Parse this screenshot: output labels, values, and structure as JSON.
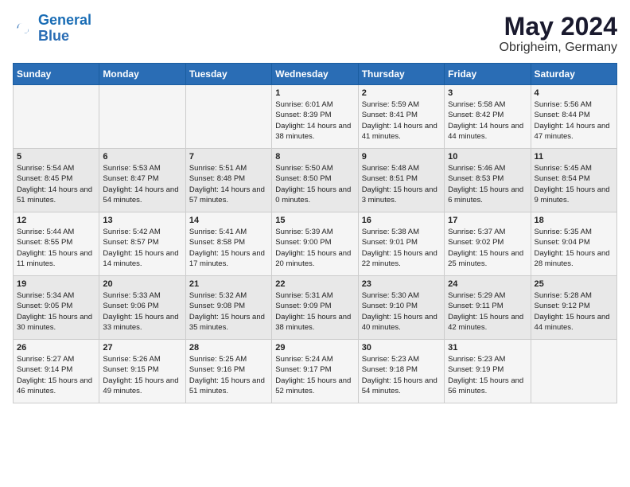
{
  "logo": {
    "line1": "General",
    "line2": "Blue"
  },
  "title": {
    "month_year": "May 2024",
    "location": "Obrigheim, Germany"
  },
  "days_of_week": [
    "Sunday",
    "Monday",
    "Tuesday",
    "Wednesday",
    "Thursday",
    "Friday",
    "Saturday"
  ],
  "weeks": [
    [
      {
        "day": "",
        "sunrise": "",
        "sunset": "",
        "daylight": ""
      },
      {
        "day": "",
        "sunrise": "",
        "sunset": "",
        "daylight": ""
      },
      {
        "day": "",
        "sunrise": "",
        "sunset": "",
        "daylight": ""
      },
      {
        "day": "1",
        "sunrise": "Sunrise: 6:01 AM",
        "sunset": "Sunset: 8:39 PM",
        "daylight": "Daylight: 14 hours and 38 minutes."
      },
      {
        "day": "2",
        "sunrise": "Sunrise: 5:59 AM",
        "sunset": "Sunset: 8:41 PM",
        "daylight": "Daylight: 14 hours and 41 minutes."
      },
      {
        "day": "3",
        "sunrise": "Sunrise: 5:58 AM",
        "sunset": "Sunset: 8:42 PM",
        "daylight": "Daylight: 14 hours and 44 minutes."
      },
      {
        "day": "4",
        "sunrise": "Sunrise: 5:56 AM",
        "sunset": "Sunset: 8:44 PM",
        "daylight": "Daylight: 14 hours and 47 minutes."
      }
    ],
    [
      {
        "day": "5",
        "sunrise": "Sunrise: 5:54 AM",
        "sunset": "Sunset: 8:45 PM",
        "daylight": "Daylight: 14 hours and 51 minutes."
      },
      {
        "day": "6",
        "sunrise": "Sunrise: 5:53 AM",
        "sunset": "Sunset: 8:47 PM",
        "daylight": "Daylight: 14 hours and 54 minutes."
      },
      {
        "day": "7",
        "sunrise": "Sunrise: 5:51 AM",
        "sunset": "Sunset: 8:48 PM",
        "daylight": "Daylight: 14 hours and 57 minutes."
      },
      {
        "day": "8",
        "sunrise": "Sunrise: 5:50 AM",
        "sunset": "Sunset: 8:50 PM",
        "daylight": "Daylight: 15 hours and 0 minutes."
      },
      {
        "day": "9",
        "sunrise": "Sunrise: 5:48 AM",
        "sunset": "Sunset: 8:51 PM",
        "daylight": "Daylight: 15 hours and 3 minutes."
      },
      {
        "day": "10",
        "sunrise": "Sunrise: 5:46 AM",
        "sunset": "Sunset: 8:53 PM",
        "daylight": "Daylight: 15 hours and 6 minutes."
      },
      {
        "day": "11",
        "sunrise": "Sunrise: 5:45 AM",
        "sunset": "Sunset: 8:54 PM",
        "daylight": "Daylight: 15 hours and 9 minutes."
      }
    ],
    [
      {
        "day": "12",
        "sunrise": "Sunrise: 5:44 AM",
        "sunset": "Sunset: 8:55 PM",
        "daylight": "Daylight: 15 hours and 11 minutes."
      },
      {
        "day": "13",
        "sunrise": "Sunrise: 5:42 AM",
        "sunset": "Sunset: 8:57 PM",
        "daylight": "Daylight: 15 hours and 14 minutes."
      },
      {
        "day": "14",
        "sunrise": "Sunrise: 5:41 AM",
        "sunset": "Sunset: 8:58 PM",
        "daylight": "Daylight: 15 hours and 17 minutes."
      },
      {
        "day": "15",
        "sunrise": "Sunrise: 5:39 AM",
        "sunset": "Sunset: 9:00 PM",
        "daylight": "Daylight: 15 hours and 20 minutes."
      },
      {
        "day": "16",
        "sunrise": "Sunrise: 5:38 AM",
        "sunset": "Sunset: 9:01 PM",
        "daylight": "Daylight: 15 hours and 22 minutes."
      },
      {
        "day": "17",
        "sunrise": "Sunrise: 5:37 AM",
        "sunset": "Sunset: 9:02 PM",
        "daylight": "Daylight: 15 hours and 25 minutes."
      },
      {
        "day": "18",
        "sunrise": "Sunrise: 5:35 AM",
        "sunset": "Sunset: 9:04 PM",
        "daylight": "Daylight: 15 hours and 28 minutes."
      }
    ],
    [
      {
        "day": "19",
        "sunrise": "Sunrise: 5:34 AM",
        "sunset": "Sunset: 9:05 PM",
        "daylight": "Daylight: 15 hours and 30 minutes."
      },
      {
        "day": "20",
        "sunrise": "Sunrise: 5:33 AM",
        "sunset": "Sunset: 9:06 PM",
        "daylight": "Daylight: 15 hours and 33 minutes."
      },
      {
        "day": "21",
        "sunrise": "Sunrise: 5:32 AM",
        "sunset": "Sunset: 9:08 PM",
        "daylight": "Daylight: 15 hours and 35 minutes."
      },
      {
        "day": "22",
        "sunrise": "Sunrise: 5:31 AM",
        "sunset": "Sunset: 9:09 PM",
        "daylight": "Daylight: 15 hours and 38 minutes."
      },
      {
        "day": "23",
        "sunrise": "Sunrise: 5:30 AM",
        "sunset": "Sunset: 9:10 PM",
        "daylight": "Daylight: 15 hours and 40 minutes."
      },
      {
        "day": "24",
        "sunrise": "Sunrise: 5:29 AM",
        "sunset": "Sunset: 9:11 PM",
        "daylight": "Daylight: 15 hours and 42 minutes."
      },
      {
        "day": "25",
        "sunrise": "Sunrise: 5:28 AM",
        "sunset": "Sunset: 9:12 PM",
        "daylight": "Daylight: 15 hours and 44 minutes."
      }
    ],
    [
      {
        "day": "26",
        "sunrise": "Sunrise: 5:27 AM",
        "sunset": "Sunset: 9:14 PM",
        "daylight": "Daylight: 15 hours and 46 minutes."
      },
      {
        "day": "27",
        "sunrise": "Sunrise: 5:26 AM",
        "sunset": "Sunset: 9:15 PM",
        "daylight": "Daylight: 15 hours and 49 minutes."
      },
      {
        "day": "28",
        "sunrise": "Sunrise: 5:25 AM",
        "sunset": "Sunset: 9:16 PM",
        "daylight": "Daylight: 15 hours and 51 minutes."
      },
      {
        "day": "29",
        "sunrise": "Sunrise: 5:24 AM",
        "sunset": "Sunset: 9:17 PM",
        "daylight": "Daylight: 15 hours and 52 minutes."
      },
      {
        "day": "30",
        "sunrise": "Sunrise: 5:23 AM",
        "sunset": "Sunset: 9:18 PM",
        "daylight": "Daylight: 15 hours and 54 minutes."
      },
      {
        "day": "31",
        "sunrise": "Sunrise: 5:23 AM",
        "sunset": "Sunset: 9:19 PM",
        "daylight": "Daylight: 15 hours and 56 minutes."
      },
      {
        "day": "",
        "sunrise": "",
        "sunset": "",
        "daylight": ""
      }
    ]
  ]
}
